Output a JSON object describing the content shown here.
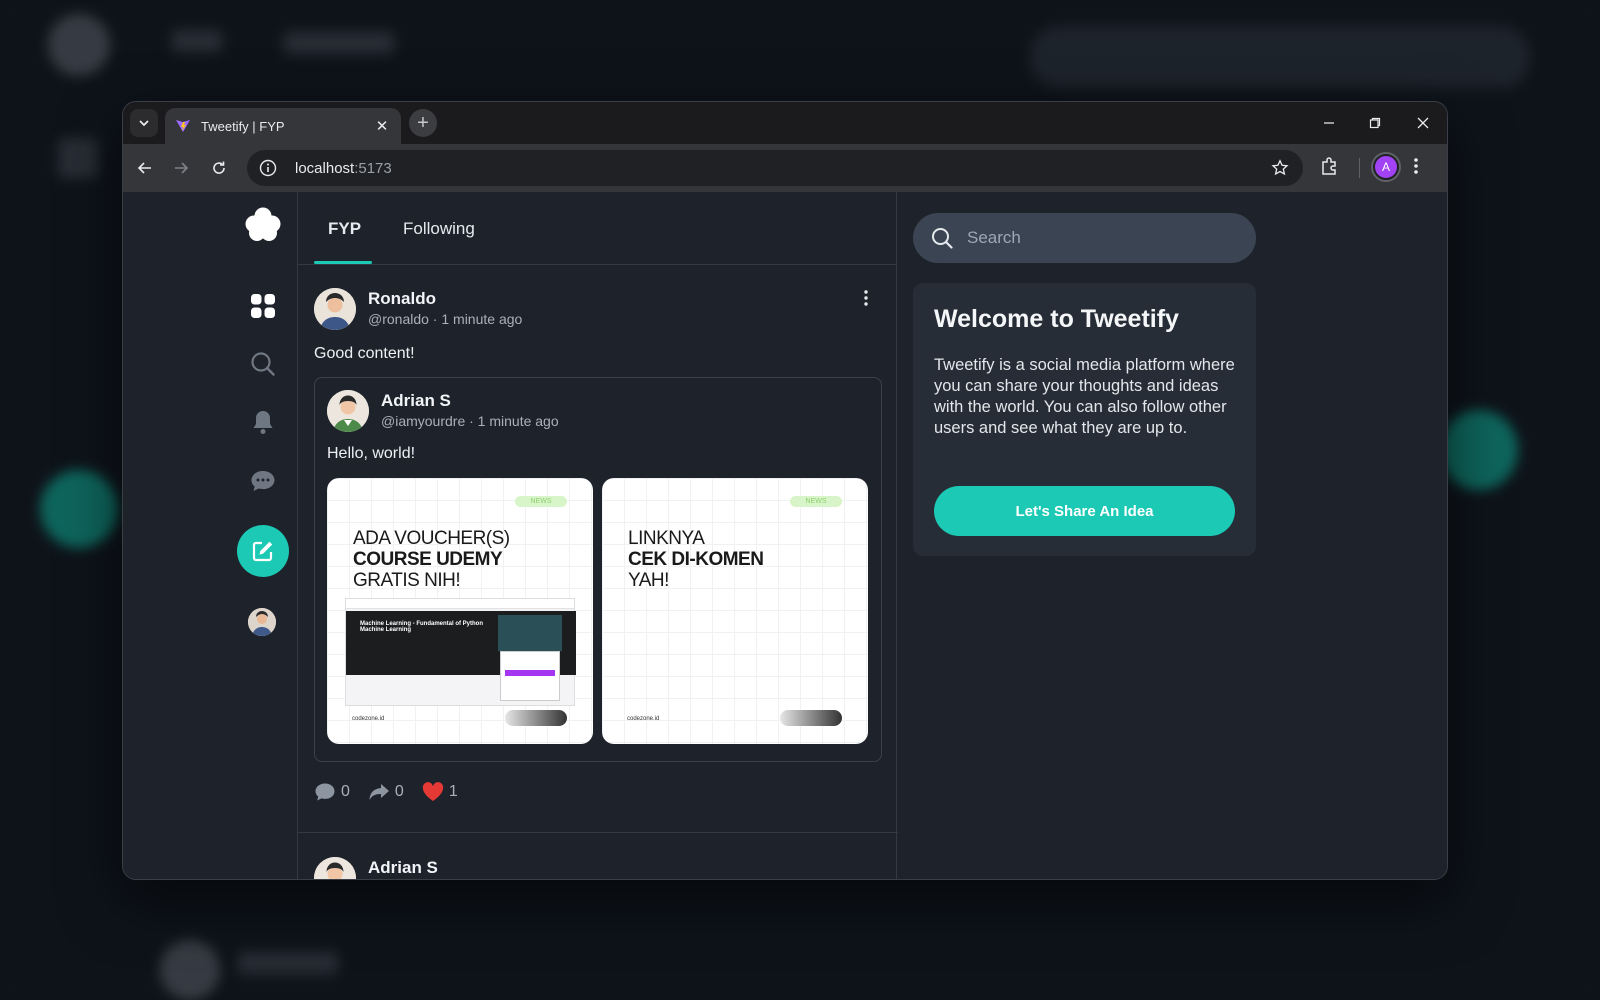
{
  "browser": {
    "tab_title": "Tweetify | FYP",
    "url_host": "localhost",
    "url_port": ":5173",
    "profile_initial": "A"
  },
  "feed": {
    "tabs": [
      "FYP",
      "Following"
    ],
    "active_tab": "FYP"
  },
  "post": {
    "author": "Ronaldo",
    "handle_time": "@ronaldo · 1 minute ago",
    "text": "Good content!",
    "quoted": {
      "author": "Adrian S",
      "handle_time": "@iamyourdre · 1 minute ago",
      "text": "Hello, world!",
      "images": [
        {
          "pill": "NEWS",
          "line1": "ADA VOUCHER(S)",
          "line2": "COURSE UDEMY",
          "line3": "GRATIS NIH!",
          "brand": "codezone.id"
        },
        {
          "pill": "NEWS",
          "line1": "LINKNYA",
          "line2": "CEK DI-KOMEN",
          "line3": "YAH!",
          "brand": "codezone.id"
        }
      ],
      "screenshot_title": "Machine Learning - Fundamental of Python Machine Learning"
    },
    "comments": "0",
    "reposts": "0",
    "likes": "1"
  },
  "next_post": {
    "author": "Adrian S"
  },
  "sidebar_right": {
    "search_placeholder": "Search",
    "welcome_title": "Welcome to Tweetify",
    "welcome_body": "Tweetify is a social media platform where you can share your thoughts and ideas with the world. You can also follow other users and see what they are up to.",
    "cta_label": "Let's Share An Idea"
  },
  "colors": {
    "accent": "#1cc9b4",
    "like": "#e53935"
  }
}
